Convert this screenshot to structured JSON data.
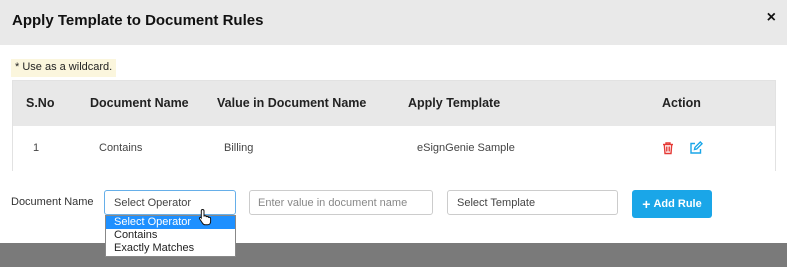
{
  "modal": {
    "title": "Apply Template to Document Rules",
    "close_label": "×"
  },
  "note": "* Use as a wildcard.",
  "table": {
    "headers": [
      "S.No",
      "Document Name",
      "Value in Document Name",
      "Apply Template",
      "Action"
    ],
    "rows": [
      {
        "sno": "1",
        "document_name": "Contains",
        "value": "Billing",
        "template": "eSignGenie Sample"
      }
    ]
  },
  "form": {
    "label": "Document Name",
    "operator_select": "Select Operator",
    "value_placeholder": "Enter value in document name",
    "template_select": "Select Template",
    "add_button": "Add Rule",
    "add_icon": "+"
  },
  "dropdown": {
    "options": [
      "Select Operator",
      "Contains",
      "Exactly Matches"
    ],
    "selected_index": 0
  },
  "colors": {
    "delete_icon": "#e53935",
    "edit_icon": "#1aa6e8",
    "accent": "#1aa6e8",
    "selection": "#1e90ff"
  }
}
